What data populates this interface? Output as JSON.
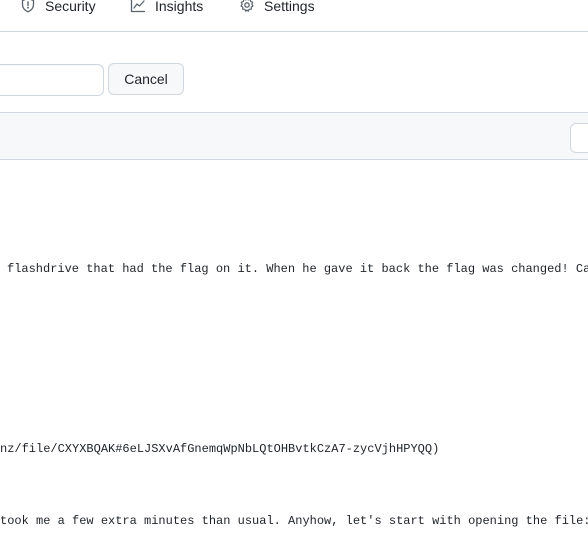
{
  "nav": {
    "security": {
      "label": "Security",
      "icon": "shield-icon"
    },
    "insights": {
      "label": "Insights",
      "icon": "graph-icon"
    },
    "settings": {
      "label": "Settings",
      "icon": "gear-icon"
    }
  },
  "edit": {
    "cancel_label": "Cancel",
    "input_value": ""
  },
  "content": {
    "lines": [
      "flashdrive that had the flag on it. When he gave it back the flag was changed! Can",
      "nz/file/CXYXBQAK#6eLJSXvAfGnemqWpNbLQtOHBvtkCzA7-zycVjhHPYQQ)",
      "took me a few extra minutes than usual. Anyhow, let's start with opening the file:"
    ]
  },
  "colors": {
    "border": "#d0d7de",
    "header_bg": "#f6f8fa",
    "text": "#1f2328"
  }
}
